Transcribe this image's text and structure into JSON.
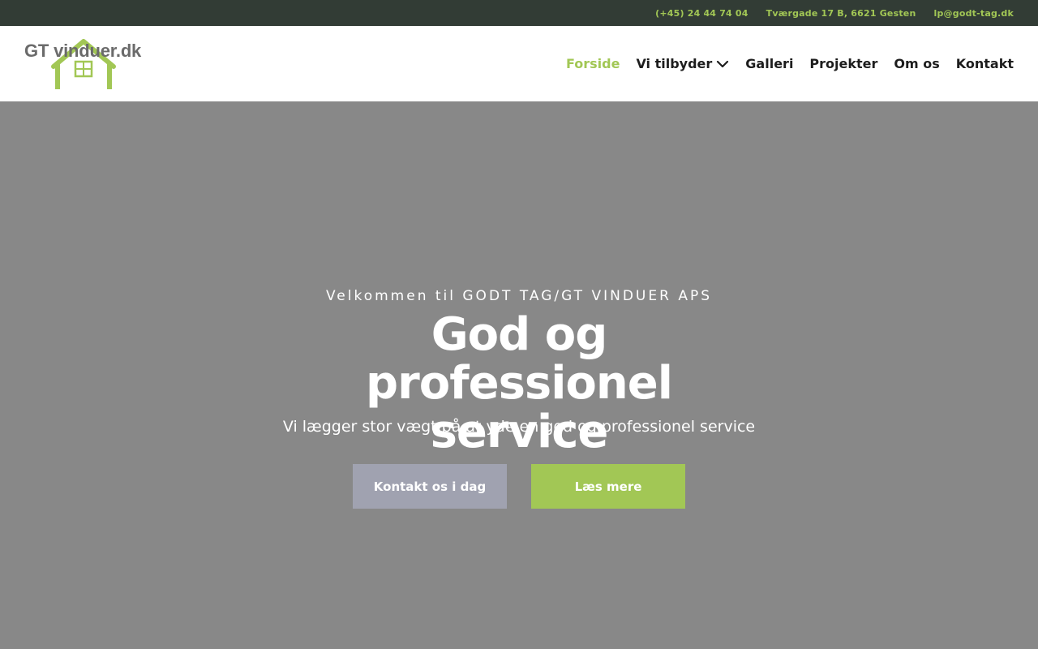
{
  "topbar": {
    "phone": "(+45) 24 44 74 04",
    "address": "Tværgade 17 B, 6621 Gesten",
    "email": "lp@godt-tag.dk"
  },
  "logo": {
    "text": "GT vinduer.dk"
  },
  "nav": {
    "items": [
      {
        "label": "Forside"
      },
      {
        "label": "Vi tilbyder"
      },
      {
        "label": "Galleri"
      },
      {
        "label": "Projekter"
      },
      {
        "label": "Om os"
      },
      {
        "label": "Kontakt"
      }
    ]
  },
  "hero": {
    "eyebrow": "Velkommen til GODT TAG/GT VINDUER APS",
    "title": "God og professionel service",
    "subtitle": "Vi lægger stor vægt på at yde en god og professionel service",
    "button_contact": "Kontakt os i dag",
    "button_more": "Læs mere"
  },
  "colors": {
    "accent": "#a2c755",
    "topbar_bg": "#323c35",
    "hero_bg": "#888888",
    "secondary_button": "#a0a2b0"
  }
}
